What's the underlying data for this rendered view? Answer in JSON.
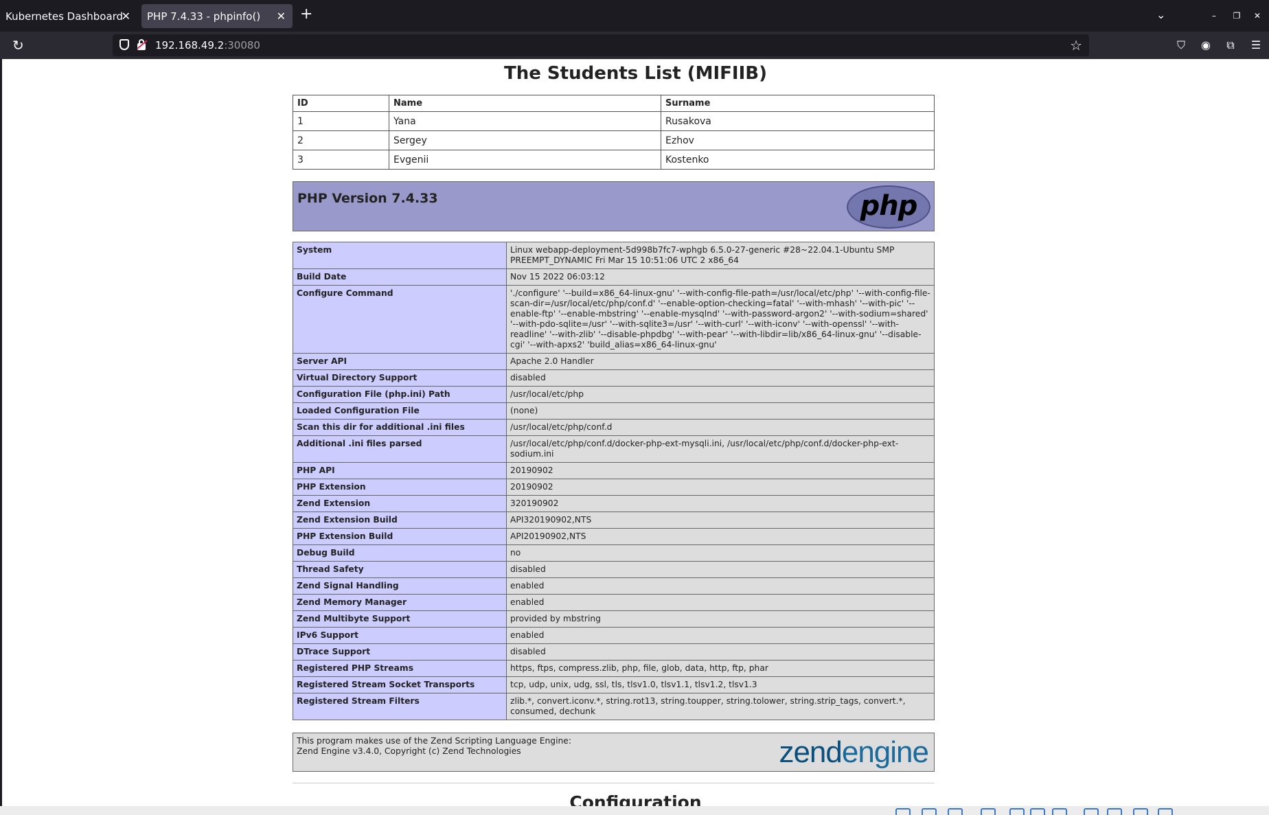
{
  "browser": {
    "tabs": [
      {
        "label": "Kubernetes Dashboard",
        "active": false
      },
      {
        "label": "PHP 7.4.33 - phpinfo()",
        "active": true
      }
    ],
    "url_host": "192.168.49.2",
    "url_port": ":30080"
  },
  "page": {
    "title": "The Students List (MIFIIB)",
    "students_table": {
      "headers": [
        "ID",
        "Name",
        "Surname"
      ],
      "rows": [
        [
          "1",
          "Yana",
          "Rusakova"
        ],
        [
          "2",
          "Sergey",
          "Ezhov"
        ],
        [
          "3",
          "Evgenii",
          "Kostenko"
        ]
      ]
    },
    "php_version": "PHP Version 7.4.33",
    "php_logo_text": "php",
    "info_rows": [
      [
        "System",
        "Linux webapp-deployment-5d998b7fc7-wphgb 6.5.0-27-generic #28~22.04.1-Ubuntu SMP PREEMPT_DYNAMIC Fri Mar 15 10:51:06 UTC 2 x86_64"
      ],
      [
        "Build Date",
        "Nov 15 2022 06:03:12"
      ],
      [
        "Configure Command",
        "'./configure' '--build=x86_64-linux-gnu' '--with-config-file-path=/usr/local/etc/php' '--with-config-file-scan-dir=/usr/local/etc/php/conf.d' '--enable-option-checking=fatal' '--with-mhash' '--with-pic' '--enable-ftp' '--enable-mbstring' '--enable-mysqlnd' '--with-password-argon2' '--with-sodium=shared' '--with-pdo-sqlite=/usr' '--with-sqlite3=/usr' '--with-curl' '--with-iconv' '--with-openssl' '--with-readline' '--with-zlib' '--disable-phpdbg' '--with-pear' '--with-libdir=lib/x86_64-linux-gnu' '--disable-cgi' '--with-apxs2' 'build_alias=x86_64-linux-gnu'"
      ],
      [
        "Server API",
        "Apache 2.0 Handler"
      ],
      [
        "Virtual Directory Support",
        "disabled"
      ],
      [
        "Configuration File (php.ini) Path",
        "/usr/local/etc/php"
      ],
      [
        "Loaded Configuration File",
        "(none)"
      ],
      [
        "Scan this dir for additional .ini files",
        "/usr/local/etc/php/conf.d"
      ],
      [
        "Additional .ini files parsed",
        "/usr/local/etc/php/conf.d/docker-php-ext-mysqli.ini, /usr/local/etc/php/conf.d/docker-php-ext-sodium.ini"
      ],
      [
        "PHP API",
        "20190902"
      ],
      [
        "PHP Extension",
        "20190902"
      ],
      [
        "Zend Extension",
        "320190902"
      ],
      [
        "Zend Extension Build",
        "API320190902,NTS"
      ],
      [
        "PHP Extension Build",
        "API20190902,NTS"
      ],
      [
        "Debug Build",
        "no"
      ],
      [
        "Thread Safety",
        "disabled"
      ],
      [
        "Zend Signal Handling",
        "enabled"
      ],
      [
        "Zend Memory Manager",
        "enabled"
      ],
      [
        "Zend Multibyte Support",
        "provided by mbstring"
      ],
      [
        "IPv6 Support",
        "enabled"
      ],
      [
        "DTrace Support",
        "disabled"
      ],
      [
        "Registered PHP Streams",
        "https, ftps, compress.zlib, php, file, glob, data, http, ftp, phar"
      ],
      [
        "Registered Stream Socket Transports",
        "tcp, udp, unix, udg, ssl, tls, tlsv1.0, tlsv1.1, tlsv1.2, tlsv1.3"
      ],
      [
        "Registered Stream Filters",
        "zlib.*, convert.iconv.*, string.rot13, string.toupper, string.tolower, string.strip_tags, convert.*, consumed, dechunk"
      ]
    ],
    "zend_line1": "This program makes use of the Zend Scripting Language Engine:",
    "zend_line2": "Zend Engine v3.4.0, Copyright (c) Zend Technologies",
    "zend_logo_part1": "zend",
    "zend_logo_part2": "engine",
    "config_heading": "Configuration"
  },
  "colors": {
    "php_header_bg": "#9999cc",
    "info_key_bg": "#ccccff",
    "info_value_bg": "#dddddd"
  }
}
